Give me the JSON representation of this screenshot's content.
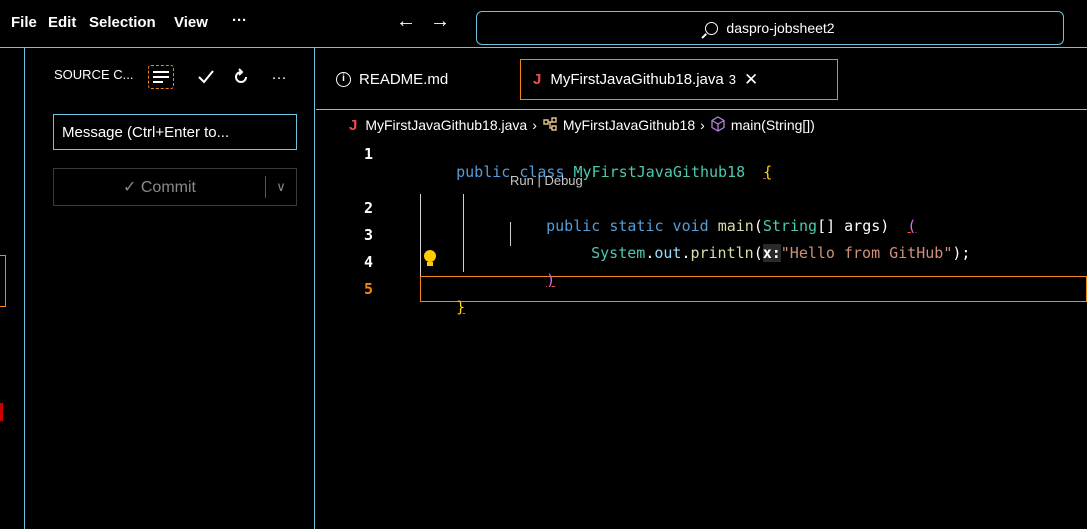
{
  "menu": {
    "file": "File",
    "edit": "Edit",
    "selection": "Selection",
    "view": "View",
    "more": "···"
  },
  "nav": {
    "back": "←",
    "forward": "→"
  },
  "command_center": {
    "text": "daspro-jobsheet2"
  },
  "sidebar": {
    "title": "SOURCE C...",
    "actions": {
      "more": "···"
    },
    "message_placeholder": "Message (Ctrl+Enter to...",
    "commit_label": "✓ Commit",
    "commit_dropdown": "∨"
  },
  "tabs": [
    {
      "label": "README.md",
      "icon": "info-icon"
    },
    {
      "label": "MyFirstJavaGithub18.java",
      "icon": "java-icon",
      "badge": "3",
      "close": "✕"
    }
  ],
  "breadcrumb": {
    "file": "MyFirstJavaGithub18.java",
    "class": "MyFirstJavaGithub18",
    "method": "main(String[])",
    "separator": "›"
  },
  "editor": {
    "line_numbers": [
      "1",
      "2",
      "3",
      "4",
      "5"
    ],
    "codelens": "Run | Debug",
    "line1": {
      "kw": "public class ",
      "cls": "MyFirstJavaGithub18",
      "brace": "{"
    },
    "line2": {
      "kw": "public static void ",
      "fn": "main",
      "open": "(",
      "cls": "String",
      "rest": "[] args)",
      "brace": "("
    },
    "line3": {
      "obj": "System",
      "dot1": ".",
      "field": "out",
      "dot2": ".",
      "fn": "println",
      "open": "(",
      "hint": "x:",
      "str": "\"Hello from GitHub\"",
      "close": ");"
    },
    "line4": {
      "brace": ")"
    },
    "line5": {
      "brace": "}"
    }
  },
  "colors": {
    "border": "#6fc3df",
    "focus": "#f38518",
    "keyword": "#569cd6",
    "class": "#4ec9b0",
    "string": "#ce9178"
  }
}
